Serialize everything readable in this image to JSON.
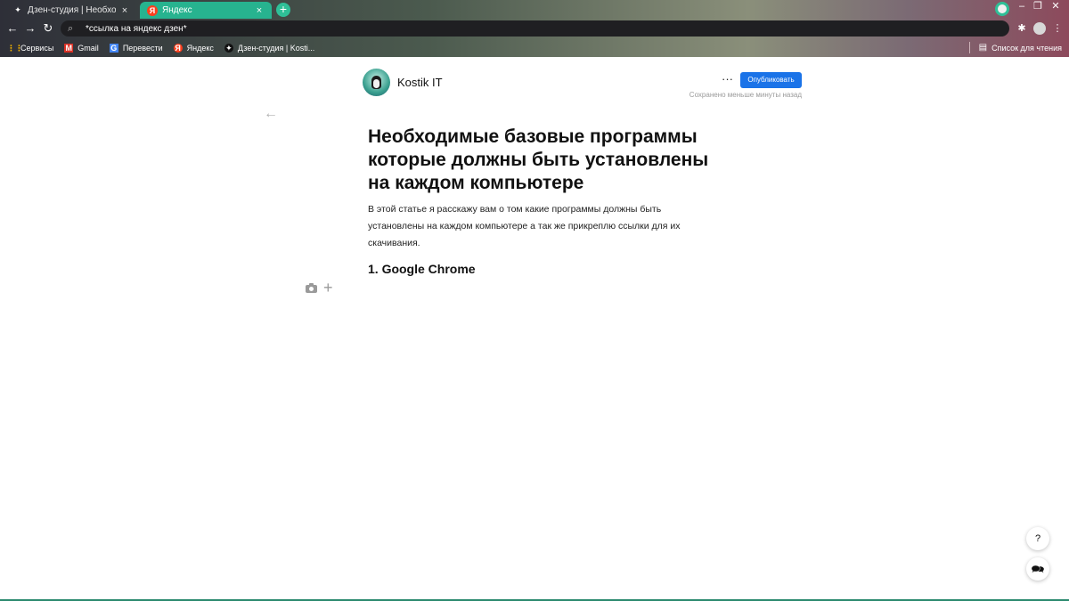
{
  "tabs": [
    {
      "title": "Дзен-студия | Необходимые ба",
      "icon": "zen-icon",
      "close": "×"
    },
    {
      "title": "Яндекс",
      "icon": "yandex-icon",
      "fav": "Я",
      "close": "×"
    }
  ],
  "newtab": "+",
  "window_controls": {
    "minimize": "–",
    "maximize": "❐",
    "close": "✕"
  },
  "nav": {
    "back": "←",
    "forward": "→",
    "reload": "↻"
  },
  "omnibox": {
    "search_icon": "⌕",
    "text": "*ссылка на яндекс дзен*"
  },
  "toolbar_icons": {
    "extensions": "✱"
  },
  "bookmarks": [
    {
      "label": "Сервисы",
      "icon": "apps-icon",
      "glyph": "⋮⋮"
    },
    {
      "label": "Gmail",
      "icon": "gmail-icon",
      "glyph": "M"
    },
    {
      "label": "Перевести",
      "icon": "translate-icon",
      "glyph": "G"
    },
    {
      "label": "Яндекс",
      "icon": "yandex-icon",
      "glyph": "Я"
    },
    {
      "label": "Дзен-студия | Kosti...",
      "icon": "zen-icon",
      "glyph": "✦"
    }
  ],
  "reading_list": {
    "label": "Список для чтения",
    "glyph": "▤"
  },
  "editor": {
    "channel_name": "Kostik IT",
    "more": "···",
    "publish_label": "Опубликовать",
    "saved_status": "Сохранено меньше минуты назад",
    "back_arrow": "←"
  },
  "article": {
    "title": "Необходимые базовые программы которые должны быть установлены на каждом компьютере",
    "lead": "В этой статье я расскажу вам о том какие программы должны быть установлены на каждом компьютере а так же прикреплю ссылки для их скачивания.",
    "heading": "1. Google Chrome"
  },
  "insert_plus": "+",
  "help_button": "?",
  "chat_button": "🗪",
  "colors": {
    "tab_active": "#27b38f",
    "publish": "#1a73e8",
    "yandex": "#fc3f1d"
  }
}
